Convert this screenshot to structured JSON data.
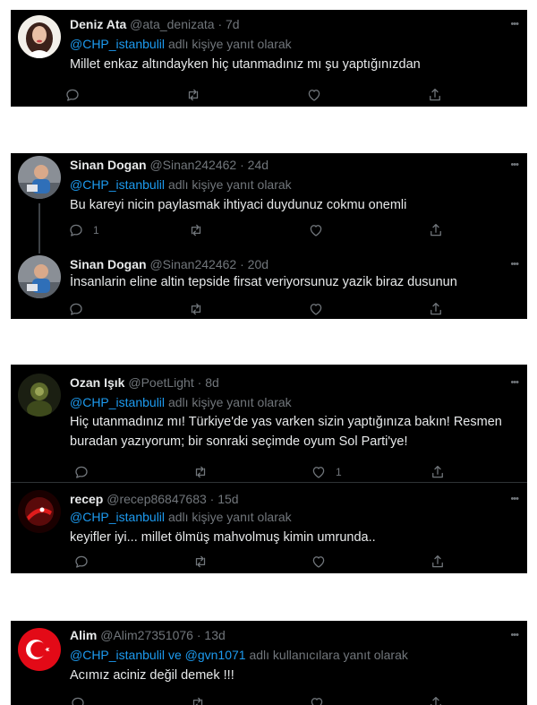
{
  "replying_to_label": "adlı kişiye yanıt olarak",
  "replying_to_multi_label": "adlı kullanıcılara yanıt olarak",
  "more_glyph": "•••",
  "dot": "·",
  "cards": [
    {
      "tweets": [
        {
          "name": "Deniz Ata",
          "handle": "@ata_denizata",
          "time": "7d",
          "reply_to": "@CHP_istanbulil",
          "text": "Millet enkaz altındayken hiç utanmadınız mı şu yaptığınızdan",
          "counts": {
            "reply": "",
            "retweet": "",
            "like": ""
          }
        }
      ]
    },
    {
      "tweets": [
        {
          "name": "Sinan Dogan",
          "handle": "@Sinan242462",
          "time": "24d",
          "reply_to": "@CHP_istanbulil",
          "text": "Bu kareyi nicin paylasmak ihtiyaci duydunuz  cokmu onemli",
          "counts": {
            "reply": "1",
            "retweet": "",
            "like": ""
          }
        },
        {
          "name": "Sinan Dogan",
          "handle": "@Sinan242462",
          "time": "20d",
          "text": "İnsanlarin eline altin tepside firsat veriyorsunuz yazik biraz dusunun",
          "counts": {
            "reply": "",
            "retweet": "",
            "like": ""
          }
        }
      ]
    },
    {
      "tweets": [
        {
          "name": "Ozan Işık",
          "handle": "@PoetLight",
          "time": "8d",
          "reply_to": "@CHP_istanbulil",
          "text": "Hiç utanmadınız mı! Türkiye'de yas varken sizin yaptığınıza bakın! Resmen buradan yazıyorum; bir sonraki seçimde oyum Sol Parti'ye!",
          "counts": {
            "reply": "",
            "retweet": "",
            "like": "1"
          }
        },
        {
          "name": "recep",
          "handle": "@recep86847683",
          "time": "15d",
          "reply_to": "@CHP_istanbulil",
          "text": "keyifler iyi... millet ölmüş mahvolmuş kimin umrunda..",
          "counts": {
            "reply": "",
            "retweet": "",
            "like": ""
          }
        }
      ]
    },
    {
      "tweets": [
        {
          "name": "Alim",
          "handle": "@Alim27351076",
          "time": "13d",
          "reply_to": "@CHP_istanbulil",
          "reply_conj": "ve",
          "reply_to_2": "@gvn1071",
          "text": "Acımız aciniz değil demek !!!",
          "counts": {
            "reply": "",
            "retweet": "",
            "like": ""
          }
        }
      ]
    }
  ]
}
